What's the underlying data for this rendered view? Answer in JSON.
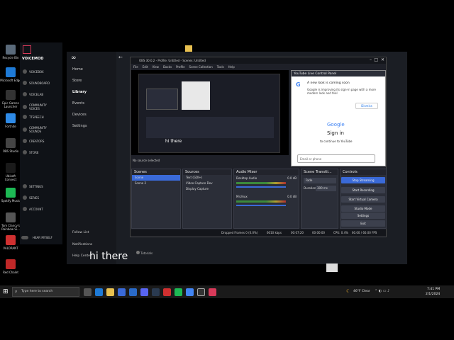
{
  "desktop_icons": [
    {
      "label": "Recycle Bin",
      "color": "#5a6a7a"
    },
    {
      "label": "Microsoft Edge",
      "color": "#1e7ad6"
    },
    {
      "label": "Epic Games Launcher",
      "color": "#333"
    },
    {
      "label": "Fortnite",
      "color": "#2e8ae6"
    },
    {
      "label": "OBS Studio",
      "color": "#444"
    },
    {
      "label": "Ubisoft Connect",
      "color": "#1a1a1a"
    },
    {
      "label": "Spotify Music",
      "color": "#1db954"
    },
    {
      "label": "Tom Clancy's Rainbow Si...",
      "color": "#555"
    },
    {
      "label": "VALORANT",
      "color": "#d03030"
    },
    {
      "label": "Red Chalet",
      "color": "#c02828"
    }
  ],
  "voicemod": {
    "brand": "VOICEMOD",
    "items": [
      "VOICEBOX",
      "SOUNDBOARD",
      "VOICELAB",
      "COMMUNITY VOICES",
      "TTSPEECH",
      "COMMUNITY SOUNDS",
      "CREATORS",
      "STORE"
    ],
    "settings": [
      "SETTINGS",
      "SERIES",
      "ACCOUNT"
    ],
    "hear_myself": "HEAR MYSELF",
    "tom_label": "Tom Clancy's Rainbow Si..."
  },
  "meta": {
    "nav": [
      "Home",
      "Store",
      "Library",
      "Events",
      "Devices",
      "Settings"
    ],
    "footer": [
      "Follow List",
      "Notifications",
      "Help Center"
    ],
    "tutorials": "Tutorials"
  },
  "obs": {
    "title": "OBS 30.0.2 - Profile: Untitled - Scenes: Untitled",
    "menu": [
      "File",
      "Edit",
      "View",
      "Docks",
      "Profile",
      "Scene Collection",
      "Tools",
      "Help"
    ],
    "no_source": "No source selected",
    "preview_text": "hi there",
    "scenes": {
      "header": "Scenes",
      "items": [
        "Scene",
        "Scene 2"
      ]
    },
    "sources": {
      "header": "Sources",
      "items": [
        "Text (GDI+)",
        "Video Capture Dev",
        "Display Capture"
      ]
    },
    "mixer": {
      "header": "Audio Mixer",
      "channels": [
        {
          "name": "Desktop Audio",
          "db": "0.0 dB"
        },
        {
          "name": "Mic/Aux",
          "db": "0.0 dB"
        }
      ]
    },
    "transitions": {
      "header": "Scene Transiti...",
      "type": "Fade",
      "duration_label": "Duration",
      "duration": "300 ms"
    },
    "controls": {
      "header": "Controls",
      "buttons": [
        "Stop Streaming",
        "Start Recording",
        "Start Virtual Camera",
        "Studio Mode",
        "Settings",
        "Exit"
      ]
    },
    "status": {
      "dropped": "Dropped Frames 0 (0.0%)",
      "bitrate": "6010 kbps",
      "live": "00:07:20",
      "rec": "00:00:00",
      "cpu": "CPU: 0.4%",
      "fps": "60.00 / 60.00 FPS"
    }
  },
  "youtube": {
    "panel_title": "YouTube Live Control Panel",
    "popup_title": "A new look is coming soon",
    "popup_body": "Google is improving its sign-in page with a more modern look and feel",
    "dismiss": "Dismiss",
    "google": "Google",
    "signin": "Sign in",
    "continue": "to continue to YouTube",
    "email_placeholder": "Email or phone"
  },
  "caption": "hi there",
  "taskbar": {
    "search": "Type here to search",
    "weather": "46°F Clear",
    "time": "7:41 PM",
    "date": "2/1/2024"
  },
  "colors": {
    "obs_bg": "#1e2028",
    "accent": "#3a6ad8",
    "voicemod": "#0f1217"
  }
}
